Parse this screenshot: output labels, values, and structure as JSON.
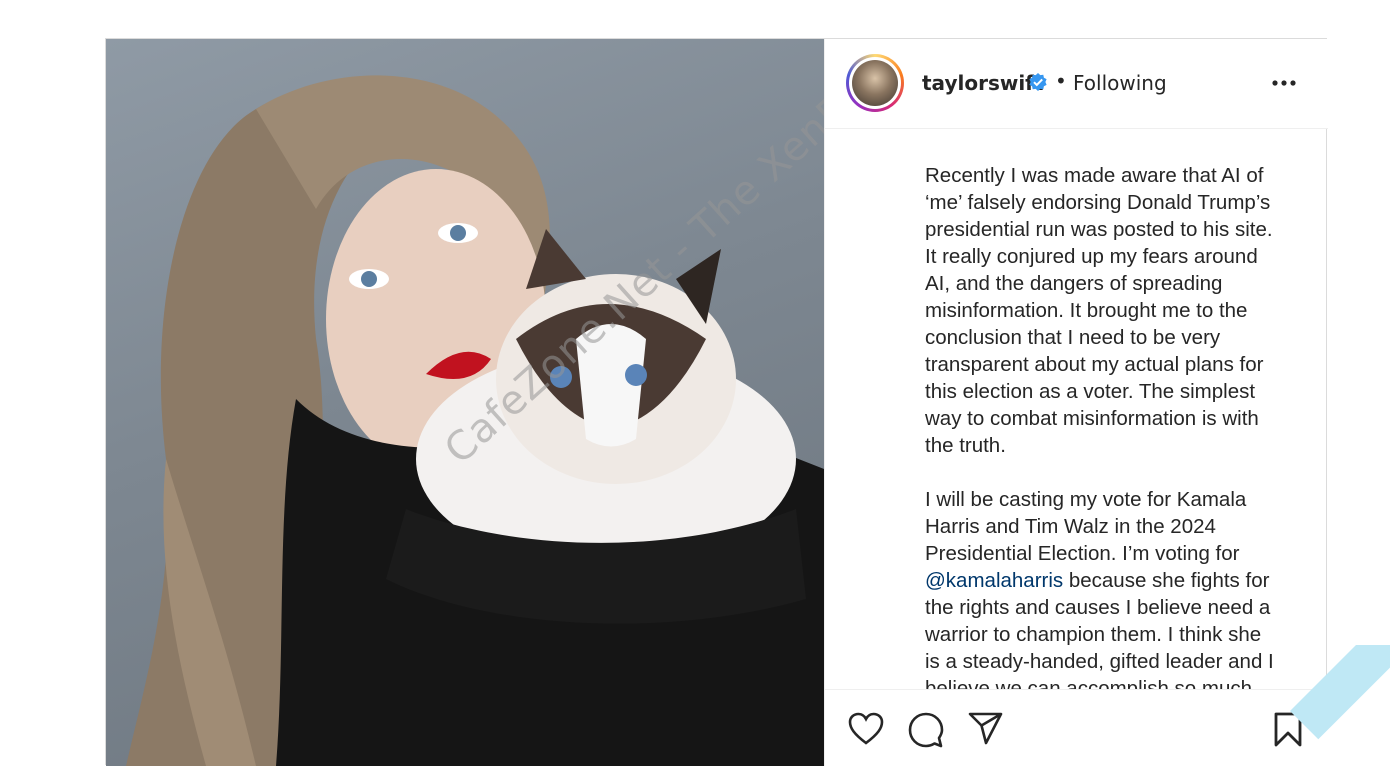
{
  "post": {
    "username": "taylorswift",
    "follow_status": "Following",
    "separator": "•",
    "caption_paragraphs": [
      "Recently I was made aware that AI of\n‘me’ falsely endorsing Donald Trump’s\npresidential run was posted to his site.\nIt really conjured up my fears around\nAI, and the dangers of spreading\nmisinformation. It brought me to the\nconclusion that I need to be very\ntransparent about my actual plans for\nthis election as a voter. The simplest\nway to combat misinformation is with\nthe truth.",
      "I will be casting my vote for Kamala\nHarris and Tim Walz in the 2024\nPresidential Election. I’m voting for"
    ],
    "mention": "@kamalaharris",
    "caption_after_mention": " because she fights for\nthe rights and causes I believe need a\nwarrior to champion them. I think she\nis a steady-handed, gifted leader and I\nbelieve we can accomplish so much"
  },
  "watermark": "CafeZone.Net - The XenForo Community",
  "badge": "CafeZone",
  "icons": {
    "verified": "verified-badge-icon",
    "more": "more-options-icon",
    "like": "heart-icon",
    "comment": "comment-icon",
    "share": "share-icon",
    "save": "bookmark-icon"
  },
  "colors": {
    "verified": "#3797f0",
    "mention": "#00376b",
    "text": "#262626"
  }
}
